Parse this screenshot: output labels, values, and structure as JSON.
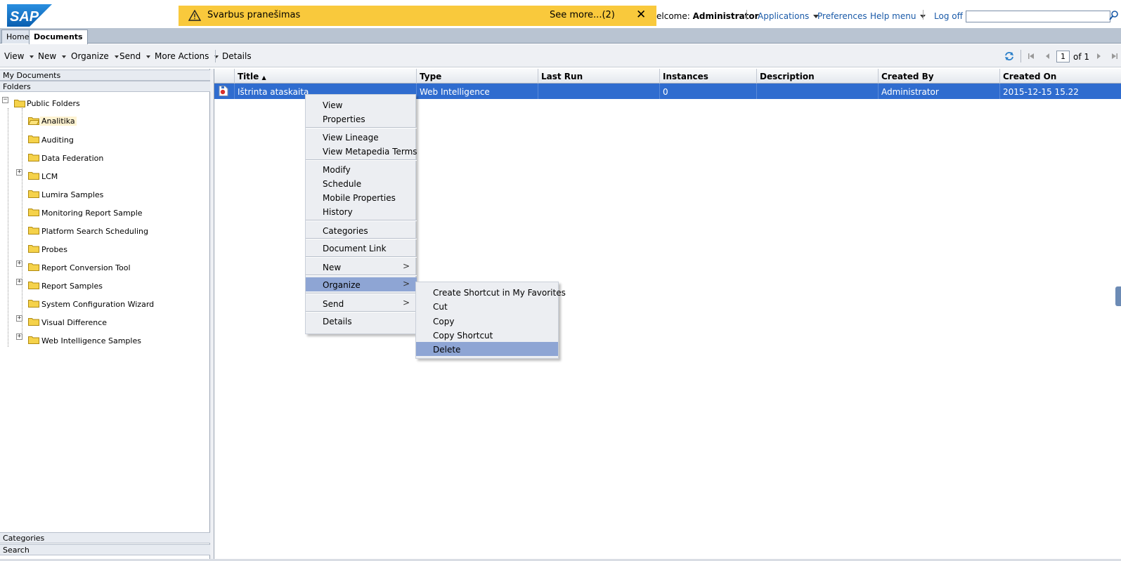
{
  "header": {
    "logo_text": "SAP",
    "notification": {
      "message": "Svarbus pranešimas",
      "see_more": "See more...(2)",
      "close": "✕"
    },
    "welcome_prefix": "elcome:",
    "user": "Administrator",
    "links": {
      "applications": "Applications",
      "preferences": "Preferences",
      "help": "Help menu",
      "logoff": "Log off"
    },
    "search_value": ""
  },
  "tabs": {
    "home": "Home",
    "documents": "Documents"
  },
  "toolbar": {
    "view": "View",
    "new": "New",
    "organize": "Organize",
    "send": "Send",
    "more_actions": "More Actions",
    "details": "Details",
    "page_current": "1",
    "page_of": "of 1"
  },
  "left": {
    "my_documents": "My Documents",
    "folders": "Folders",
    "root": "Public Folders",
    "items": [
      {
        "label": "Analitika"
      },
      {
        "label": "Auditing"
      },
      {
        "label": "Data Federation"
      },
      {
        "label": "LCM"
      },
      {
        "label": "Lumira Samples"
      },
      {
        "label": "Monitoring Report Sample"
      },
      {
        "label": "Platform Search Scheduling"
      },
      {
        "label": "Probes"
      },
      {
        "label": "Report Conversion Tool"
      },
      {
        "label": "Report Samples"
      },
      {
        "label": "System Configuration Wizard"
      },
      {
        "label": "Visual Difference"
      },
      {
        "label": "Web Intelligence Samples"
      }
    ],
    "categories": "Categories",
    "search": "Search"
  },
  "grid": {
    "columns": [
      "Title",
      "Type",
      "Last Run",
      "Instances",
      "Description",
      "Created By",
      "Created On"
    ],
    "sort_indicator": "▲",
    "row": {
      "title": "Ištrinta ataskaita",
      "type": "Web Intelligence",
      "last_run": "",
      "instances": "0",
      "description": "",
      "created_by": "Administrator",
      "created_on": "2015-12-15 15.22"
    }
  },
  "context_menu": {
    "items": [
      "View",
      "Properties",
      "View Lineage",
      "View Metapedia Terms",
      "Modify",
      "Schedule",
      "Mobile Properties",
      "History",
      "Categories",
      "Document Link",
      "New",
      "Organize",
      "Send",
      "Details"
    ],
    "submenu_arrow": ">",
    "submenu": [
      "Create Shortcut in My Favorites",
      "Cut",
      "Copy",
      "Copy Shortcut",
      "Delete"
    ]
  },
  "colors": {
    "selection": "#2f6ccf",
    "menu_highlight": "#8ea5d4",
    "notification": "#f9c93c",
    "link": "#1a5aa8"
  }
}
